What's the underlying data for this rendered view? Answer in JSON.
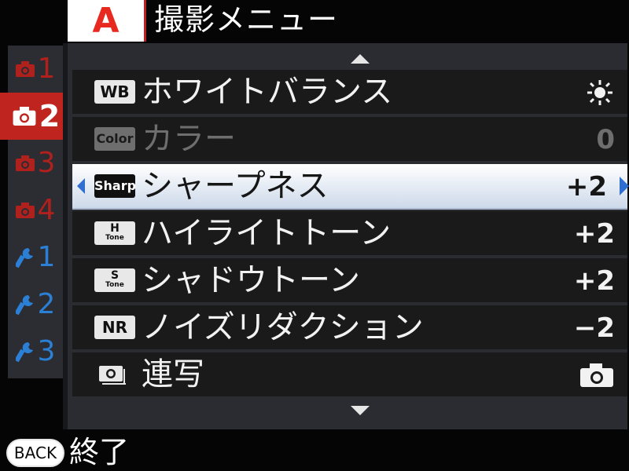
{
  "header": {
    "mode_letter": "A",
    "title": "撮影メニュー"
  },
  "side_tabs": [
    {
      "number": "1",
      "icon": "camera-icon",
      "color": "#b0201c",
      "active": false
    },
    {
      "number": "2",
      "icon": "camera-icon",
      "color": "#ffffff",
      "active": true
    },
    {
      "number": "3",
      "icon": "camera-icon",
      "color": "#b0201c",
      "active": false
    },
    {
      "number": "4",
      "icon": "camera-icon",
      "color": "#b0201c",
      "active": false
    },
    {
      "number": "1",
      "icon": "wrench-icon",
      "color": "#2b7fd4",
      "active": false
    },
    {
      "number": "2",
      "icon": "wrench-icon",
      "color": "#2b7fd4",
      "active": false
    },
    {
      "number": "3",
      "icon": "wrench-icon",
      "color": "#2b7fd4",
      "active": false
    }
  ],
  "menu": {
    "items": [
      {
        "icon_text": "WB",
        "label": "ホワイトバランス",
        "value": "",
        "value_icon": "sun-icon",
        "state": "normal"
      },
      {
        "icon_text": "Color",
        "label": "カラー",
        "value": "0",
        "state": "disabled"
      },
      {
        "icon_text": "Sharp",
        "label": "シャープネス",
        "value": "+2",
        "state": "selected"
      },
      {
        "icon_text": "H",
        "icon_sub": "Tone",
        "label": "ハイライトトーン",
        "value": "+2",
        "state": "normal"
      },
      {
        "icon_text": "S",
        "icon_sub": "Tone",
        "label": "シャドウトーン",
        "value": "+2",
        "state": "normal"
      },
      {
        "icon_text": "NR",
        "label": "ノイズリダクション",
        "value": "−2",
        "state": "normal"
      },
      {
        "icon_text": "",
        "label": "連写",
        "value": "",
        "value_icon": "camera-icon",
        "state": "normal"
      }
    ]
  },
  "footer": {
    "back_key": "BACK",
    "back_label": "終了"
  },
  "colors": {
    "accent_red": "#c0241e",
    "selection_arrow": "#2f6fd0",
    "panel": "#2a2c32"
  }
}
